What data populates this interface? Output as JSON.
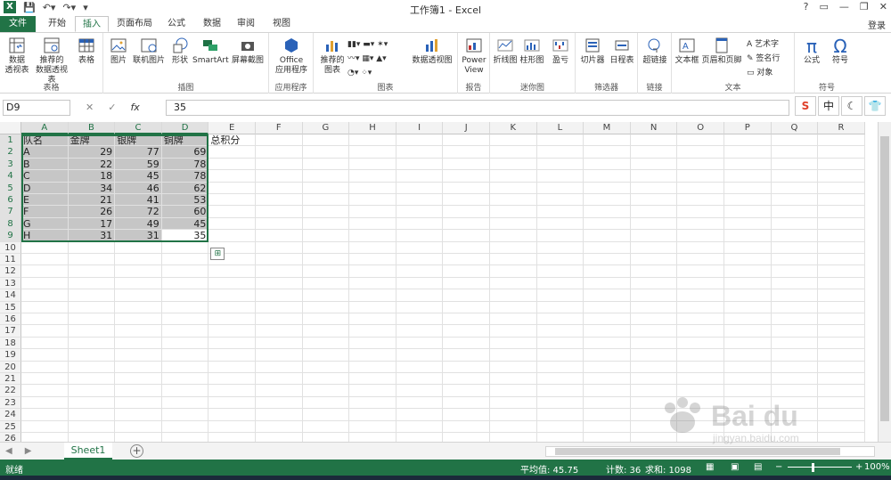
{
  "window": {
    "title": "工作簿1 - Excel",
    "help": "?",
    "login": "登录"
  },
  "tabs": [
    "文件",
    "开始",
    "插入",
    "页面布局",
    "公式",
    "数据",
    "审阅",
    "视图"
  ],
  "ribbon": {
    "groups": [
      {
        "label": "表格",
        "buttons": [
          "数据\n透视表",
          "推荐的\n数据透视表",
          "表格"
        ]
      },
      {
        "label": "插图",
        "buttons": [
          "图片",
          "联机图片",
          "形状",
          "SmartArt",
          "屏幕截图"
        ]
      },
      {
        "label": "应用程序",
        "buttons": [
          "Office\n应用程序"
        ]
      },
      {
        "label": "图表",
        "buttons": [
          "推荐的\n图表",
          "数据透视图"
        ]
      },
      {
        "label": "报告",
        "buttons": [
          "Power\nView"
        ]
      },
      {
        "label": "迷你图",
        "buttons": [
          "折线图",
          "柱形图",
          "盈亏"
        ]
      },
      {
        "label": "筛选器",
        "buttons": [
          "切片器",
          "日程表"
        ]
      },
      {
        "label": "链接",
        "buttons": [
          "超链接"
        ]
      },
      {
        "label": "文本",
        "buttons": [
          "文本框",
          "页眉和页脚"
        ],
        "small": [
          "艺术字",
          "签名行",
          "对象"
        ]
      },
      {
        "label": "符号",
        "buttons": [
          "公式",
          "符号"
        ]
      }
    ]
  },
  "formula_bar": {
    "name_box": "D9",
    "value": "35"
  },
  "ime": [
    "S",
    "中",
    "☾",
    "👕"
  ],
  "sheet": {
    "columns": [
      "A",
      "B",
      "C",
      "D",
      "E",
      "F",
      "G",
      "H",
      "I",
      "J",
      "K",
      "L",
      "M",
      "N",
      "O",
      "P",
      "Q",
      "R"
    ],
    "row_count": 26,
    "header_row": [
      "队名",
      "金牌",
      "银牌",
      "铜牌",
      "总积分"
    ],
    "rows": [
      [
        "A",
        29,
        77,
        69
      ],
      [
        "B",
        22,
        59,
        78
      ],
      [
        "C",
        18,
        45,
        78
      ],
      [
        "D",
        34,
        46,
        62
      ],
      [
        "E",
        21,
        41,
        53
      ],
      [
        "F",
        26,
        72,
        60
      ],
      [
        "G",
        17,
        49,
        45
      ],
      [
        "H",
        31,
        31,
        35
      ]
    ],
    "selected_range": "A1:D9",
    "active_cell": "D9"
  },
  "sheet_tabs": [
    "Sheet1"
  ],
  "status": {
    "ready": "就绪",
    "average": "平均值: 45.75",
    "count": "计数: 36",
    "sum": "求和: 1098",
    "zoom": "100%"
  },
  "colors": {
    "brand": "#217346",
    "selection": "#c6c6c6"
  }
}
